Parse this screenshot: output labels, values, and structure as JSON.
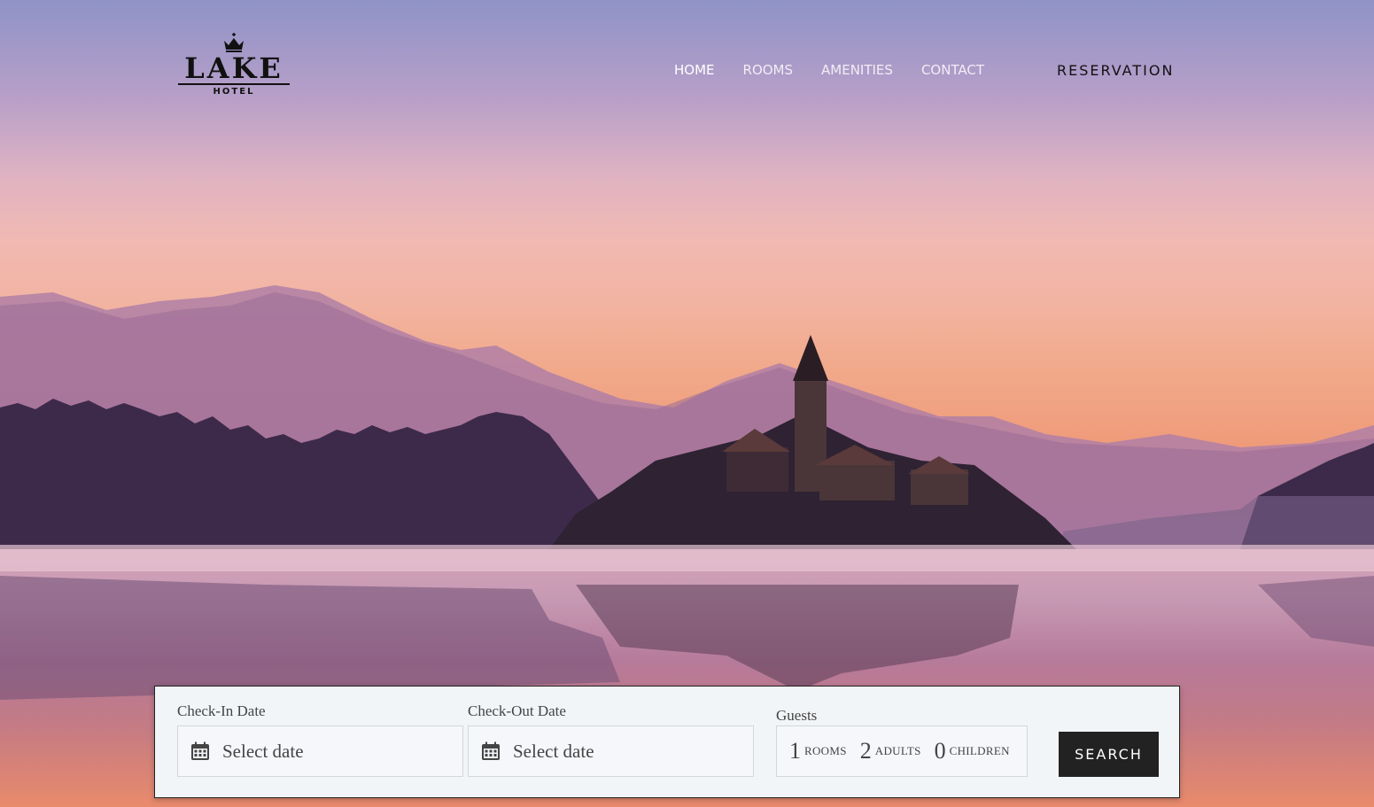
{
  "brand": {
    "name": "LAKE",
    "subtitle": "HOTEL",
    "icon": "crown-icon"
  },
  "nav": {
    "items": [
      {
        "label": "HOME",
        "active": true
      },
      {
        "label": "ROOMS",
        "active": false
      },
      {
        "label": "AMENITIES",
        "active": false
      },
      {
        "label": "CONTACT",
        "active": false
      }
    ],
    "reservation_label": "RESERVATION"
  },
  "booking": {
    "check_in": {
      "label": "Check-In Date",
      "placeholder": "Select date",
      "icon": "calendar-icon"
    },
    "check_out": {
      "label": "Check-Out Date",
      "placeholder": "Select date",
      "icon": "calendar-icon"
    },
    "guests": {
      "label": "Guests",
      "rooms": {
        "count": "1",
        "unit": "ROOMS"
      },
      "adults": {
        "count": "2",
        "unit": "ADULTS"
      },
      "children": {
        "count": "0",
        "unit": "CHILDREN"
      }
    },
    "search_label": "SEARCH"
  },
  "colors": {
    "button_bg": "#222222",
    "panel_bg": "#f2f5f8",
    "nav_text": "#ffffff"
  }
}
